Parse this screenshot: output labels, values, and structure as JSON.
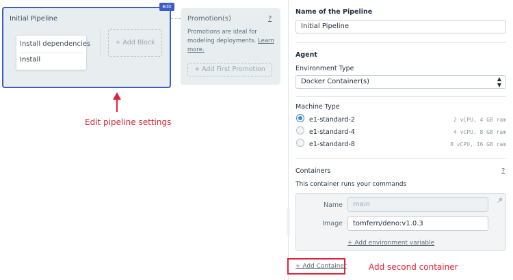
{
  "canvas": {
    "pipeline": {
      "title": "Initial Pipeline",
      "edit_badge": "Edit",
      "block": {
        "title": "Install dependencies",
        "job": "Install"
      },
      "add_block_label": "+ Add Block"
    },
    "promotions": {
      "title": "Promotion(s)",
      "help": "?",
      "description": "Promotions are ideal for modeling deployments.",
      "learn_more": "Learn more.",
      "add_first_label": "+ Add First Promotion"
    },
    "annotation_left": "Edit pipeline settings"
  },
  "panel": {
    "pipeline_name_label": "Name of the Pipeline",
    "pipeline_name_value": "Initial Pipeline",
    "agent_heading": "Agent",
    "environment_type_label": "Environment Type",
    "environment_type_value": "Docker Container(s)",
    "machine_type_label": "Machine Type",
    "machine_types": [
      {
        "name": "e1-standard-2",
        "spec": "2 vCPU, 4 GB ram",
        "selected": true
      },
      {
        "name": "e1-standard-4",
        "spec": "4 vCPU, 8 GB ram",
        "selected": false
      },
      {
        "name": "e1-standard-8",
        "spec": "8 vCPU, 16 GB ram",
        "selected": false
      }
    ],
    "containers_label": "Containers",
    "containers_help": "?",
    "containers_description": "This container runs your commands",
    "container": {
      "name_label": "Name",
      "name_placeholder": "main",
      "image_label": "Image",
      "image_value": "tomfern/deno:v1.0.3",
      "add_env_var_label": "+ Add environment variable"
    },
    "add_container_label": "+ Add Container",
    "annotation_right": "Add second container"
  },
  "colors": {
    "accent_blue": "#3b5cc5",
    "annotation_red": "#e0213a",
    "radio_blue": "#3b8bd9",
    "card_bg": "#e8eef0"
  }
}
